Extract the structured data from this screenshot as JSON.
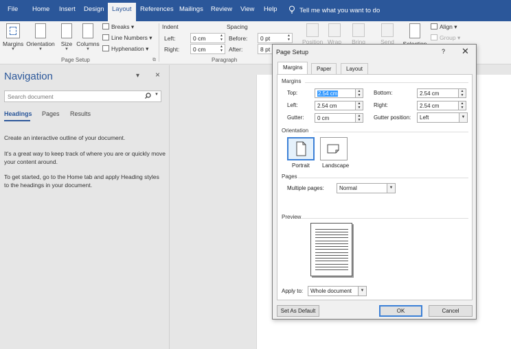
{
  "ribbon_tabs": [
    "File",
    "Home",
    "Insert",
    "Design",
    "Layout",
    "References",
    "Mailings",
    "Review",
    "View",
    "Help"
  ],
  "active_tab": "Layout",
  "tell_me": "Tell me what you want to do",
  "page_setup_group": {
    "label": "Page Setup",
    "margins": "Margins",
    "orientation": "Orientation",
    "size": "Size",
    "columns": "Columns",
    "breaks": "Breaks",
    "line_numbers": "Line Numbers",
    "hyphenation": "Hyphenation"
  },
  "paragraph_group": {
    "label": "Paragraph",
    "indent": "Indent",
    "spacing": "Spacing",
    "left_label": "Left:",
    "left_value": "0 cm",
    "right_label": "Right:",
    "right_value": "0 cm",
    "before_label": "Before:",
    "before_value": "0 pt",
    "after_label": "After:",
    "after_value": "8 pt"
  },
  "arrange_group": {
    "position": "Position",
    "wrap": "Wrap",
    "bring": "Bring",
    "send": "Send",
    "selection": "Selection",
    "align": "Align",
    "group": "Group"
  },
  "navigation": {
    "title": "Navigation",
    "search_placeholder": "Search document",
    "tabs": [
      "Headings",
      "Pages",
      "Results"
    ],
    "paragraphs": [
      "Create an interactive outline of your document.",
      "It's a great way to keep track of where you are or quickly move your content around.",
      "To get started, go to the Home tab and apply Heading styles to the headings in your document."
    ]
  },
  "dialog": {
    "title": "Page Setup",
    "help": "?",
    "tabs": [
      "Margins",
      "Paper",
      "Layout"
    ],
    "margins_section": "Margins",
    "top_label": "Top:",
    "top_value": "2.54 cm",
    "bottom_label": "Bottom:",
    "bottom_value": "2.54 cm",
    "left_label": "Left:",
    "left_value": "2.54 cm",
    "right_label": "Right:",
    "right_value": "2.54 cm",
    "gutter_label": "Gutter:",
    "gutter_value": "0 cm",
    "gutter_position_label": "Gutter position:",
    "gutter_position_value": "Left",
    "orientation_section": "Orientation",
    "portrait": "Portrait",
    "landscape": "Landscape",
    "pages_section": "Pages",
    "multiple_pages_label": "Multiple pages:",
    "multiple_pages_value": "Normal",
    "preview_section": "Preview",
    "apply_to_label": "Apply to:",
    "apply_to_value": "Whole document",
    "set_default": "Set As Default",
    "ok": "OK",
    "cancel": "Cancel"
  },
  "colors": {
    "accent": "#2b579a",
    "selection": "#3399ff"
  }
}
